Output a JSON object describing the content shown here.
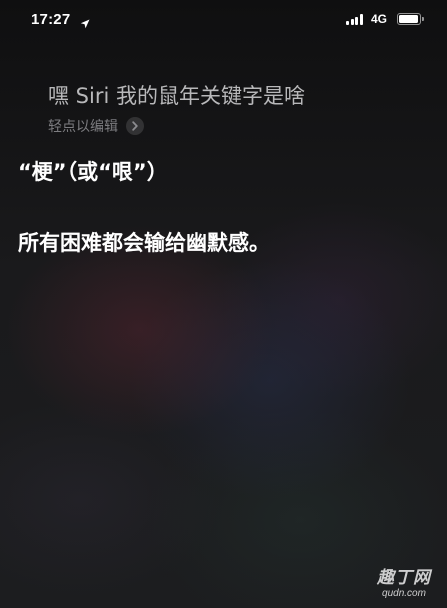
{
  "status_bar": {
    "time": "17:27",
    "network": "4G",
    "icons": {
      "location": "location-arrow-icon",
      "signal": "cellular-signal-icon",
      "battery": "battery-icon"
    }
  },
  "siri": {
    "query": "嘿 Siri 我的鼠年关键字是啥",
    "edit_hint": "轻点以编辑",
    "edit_icon": "chevron-right-icon"
  },
  "response": {
    "line1": "“梗”（或“哏”）",
    "line2": "所有困难都会输给幽默感。"
  },
  "watermark": {
    "name": "趣丁网",
    "url": "qudn.com"
  },
  "colors": {
    "background": "#151515",
    "query_text": "#b8b8ba",
    "hint_text": "#7c7c80",
    "response_text": "#ffffff"
  }
}
